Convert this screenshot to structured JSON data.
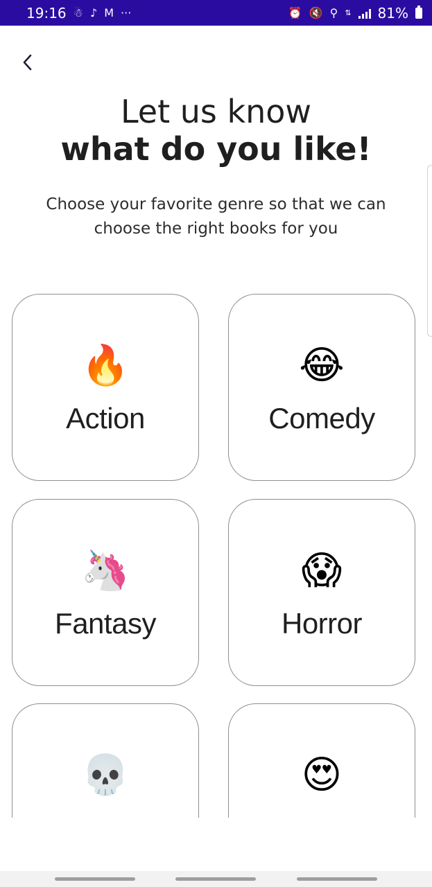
{
  "status_bar": {
    "time": "19:16",
    "battery": "81%",
    "more": "···",
    "background_color": "#2a0da0"
  },
  "header": {
    "back_icon": "chevron-left-icon",
    "title_line1": "Let us know",
    "title_line2": "what do you like!",
    "subtitle": "Choose your favorite genre so that we can choose the right books for you"
  },
  "genres": [
    {
      "label": "Action",
      "emoji": "🔥",
      "icon": "fire-icon"
    },
    {
      "label": "Comedy",
      "emoji": "😂",
      "icon": "laughing-face-icon"
    },
    {
      "label": "Fantasy",
      "emoji": "🦄",
      "icon": "unicorn-icon"
    },
    {
      "label": "Horror",
      "emoji": "😱",
      "icon": "screaming-face-icon"
    },
    {
      "label": "",
      "emoji": "💀",
      "icon": "skull-icon"
    },
    {
      "label": "",
      "emoji": "😍",
      "icon": "heart-eyes-face-icon"
    }
  ]
}
